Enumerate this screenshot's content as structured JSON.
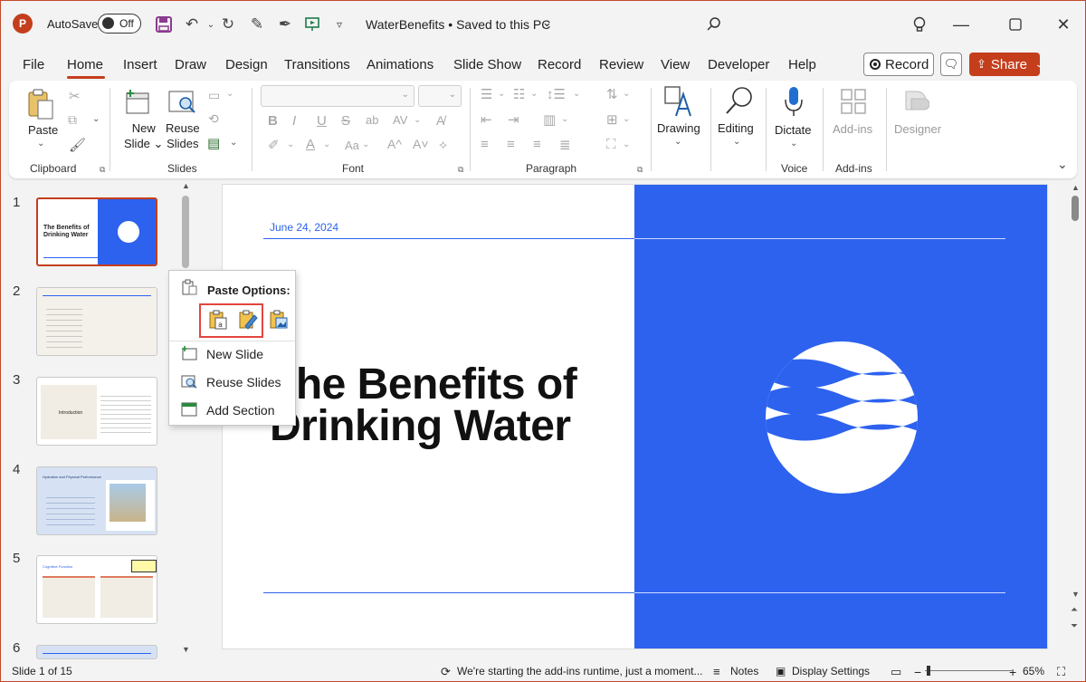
{
  "app": {
    "autosave_label": "AutoSave",
    "autosave_state": "Off",
    "document_title": "WaterBenefits • Saved to this PC",
    "brand_color": "#c43e1c"
  },
  "menu": {
    "tabs": [
      "File",
      "Home",
      "Insert",
      "Draw",
      "Design",
      "Transitions",
      "Animations",
      "Slide Show",
      "Record",
      "Review",
      "View",
      "Developer",
      "Help"
    ],
    "active_tab": "Home",
    "record_label": "Record",
    "share_label": "Share"
  },
  "ribbon": {
    "clipboard": {
      "paste": "Paste",
      "group": "Clipboard"
    },
    "slides": {
      "new_slide_1": "New",
      "new_slide_2": "Slide",
      "reuse_1": "Reuse",
      "reuse_2": "Slides",
      "group": "Slides"
    },
    "font": {
      "group": "Font",
      "bold": "B",
      "italic": "I",
      "underline": "U",
      "strike": "S",
      "font_size_label": "Aa"
    },
    "paragraph": {
      "group": "Paragraph"
    },
    "drawing": {
      "label": "Drawing"
    },
    "editing": {
      "label": "Editing"
    },
    "voice": {
      "label": "Dictate",
      "group": "Voice"
    },
    "addins": {
      "label": "Add-ins",
      "group": "Add-ins"
    },
    "designer": {
      "label": "Designer"
    }
  },
  "thumbnails": [
    {
      "num": "1",
      "title": "The Benefits of Drinking Water"
    },
    {
      "num": "2"
    },
    {
      "num": "3",
      "title": "Introduction"
    },
    {
      "num": "4",
      "title": "Hydration and Physical Performance"
    },
    {
      "num": "5",
      "title": "Cognitive Function"
    },
    {
      "num": "6"
    }
  ],
  "slide": {
    "date": "June 24, 2024",
    "title_line1": "The Benefits of",
    "title_line2": "Drinking Water",
    "accent": "#2d62ef"
  },
  "context_menu": {
    "title": "Paste Options:",
    "new_slide": "New Slide",
    "reuse_slides": "Reuse Slides",
    "add_section": "Add Section"
  },
  "status": {
    "slide_counter": "Slide 1 of 15",
    "addins_msg": "We're starting the add-ins runtime, just a moment...",
    "notes": "Notes",
    "display_settings": "Display Settings",
    "zoom": "65%"
  }
}
